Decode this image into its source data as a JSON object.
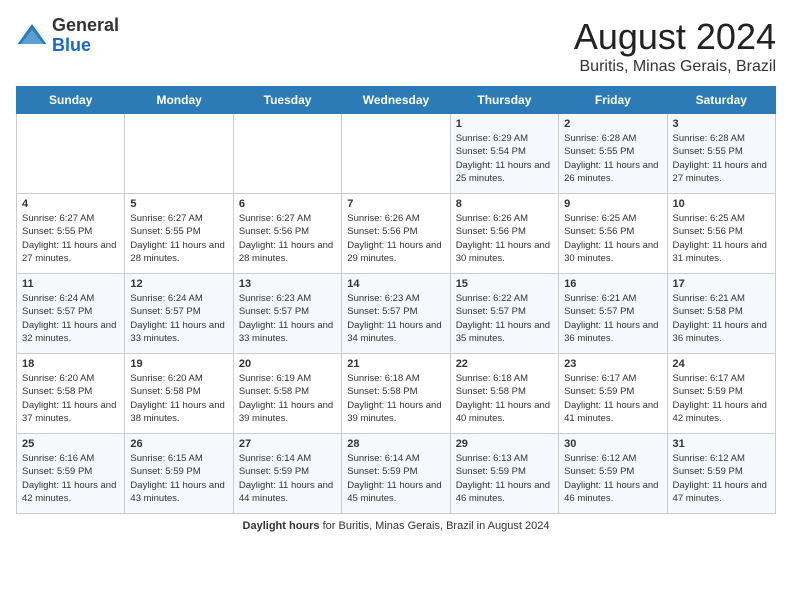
{
  "app": {
    "logo_general": "General",
    "logo_blue": "Blue"
  },
  "header": {
    "title": "August 2024",
    "subtitle": "Buritis, Minas Gerais, Brazil"
  },
  "calendar": {
    "days_of_week": [
      "Sunday",
      "Monday",
      "Tuesday",
      "Wednesday",
      "Thursday",
      "Friday",
      "Saturday"
    ],
    "weeks": [
      [
        {
          "day": "",
          "info": ""
        },
        {
          "day": "",
          "info": ""
        },
        {
          "day": "",
          "info": ""
        },
        {
          "day": "",
          "info": ""
        },
        {
          "day": "1",
          "info": "Sunrise: 6:29 AM\nSunset: 5:54 PM\nDaylight: 11 hours and 25 minutes."
        },
        {
          "day": "2",
          "info": "Sunrise: 6:28 AM\nSunset: 5:55 PM\nDaylight: 11 hours and 26 minutes."
        },
        {
          "day": "3",
          "info": "Sunrise: 6:28 AM\nSunset: 5:55 PM\nDaylight: 11 hours and 27 minutes."
        }
      ],
      [
        {
          "day": "4",
          "info": "Sunrise: 6:27 AM\nSunset: 5:55 PM\nDaylight: 11 hours and 27 minutes."
        },
        {
          "day": "5",
          "info": "Sunrise: 6:27 AM\nSunset: 5:55 PM\nDaylight: 11 hours and 28 minutes."
        },
        {
          "day": "6",
          "info": "Sunrise: 6:27 AM\nSunset: 5:56 PM\nDaylight: 11 hours and 28 minutes."
        },
        {
          "day": "7",
          "info": "Sunrise: 6:26 AM\nSunset: 5:56 PM\nDaylight: 11 hours and 29 minutes."
        },
        {
          "day": "8",
          "info": "Sunrise: 6:26 AM\nSunset: 5:56 PM\nDaylight: 11 hours and 30 minutes."
        },
        {
          "day": "9",
          "info": "Sunrise: 6:25 AM\nSunset: 5:56 PM\nDaylight: 11 hours and 30 minutes."
        },
        {
          "day": "10",
          "info": "Sunrise: 6:25 AM\nSunset: 5:56 PM\nDaylight: 11 hours and 31 minutes."
        }
      ],
      [
        {
          "day": "11",
          "info": "Sunrise: 6:24 AM\nSunset: 5:57 PM\nDaylight: 11 hours and 32 minutes."
        },
        {
          "day": "12",
          "info": "Sunrise: 6:24 AM\nSunset: 5:57 PM\nDaylight: 11 hours and 33 minutes."
        },
        {
          "day": "13",
          "info": "Sunrise: 6:23 AM\nSunset: 5:57 PM\nDaylight: 11 hours and 33 minutes."
        },
        {
          "day": "14",
          "info": "Sunrise: 6:23 AM\nSunset: 5:57 PM\nDaylight: 11 hours and 34 minutes."
        },
        {
          "day": "15",
          "info": "Sunrise: 6:22 AM\nSunset: 5:57 PM\nDaylight: 11 hours and 35 minutes."
        },
        {
          "day": "16",
          "info": "Sunrise: 6:21 AM\nSunset: 5:57 PM\nDaylight: 11 hours and 36 minutes."
        },
        {
          "day": "17",
          "info": "Sunrise: 6:21 AM\nSunset: 5:58 PM\nDaylight: 11 hours and 36 minutes."
        }
      ],
      [
        {
          "day": "18",
          "info": "Sunrise: 6:20 AM\nSunset: 5:58 PM\nDaylight: 11 hours and 37 minutes."
        },
        {
          "day": "19",
          "info": "Sunrise: 6:20 AM\nSunset: 5:58 PM\nDaylight: 11 hours and 38 minutes."
        },
        {
          "day": "20",
          "info": "Sunrise: 6:19 AM\nSunset: 5:58 PM\nDaylight: 11 hours and 39 minutes."
        },
        {
          "day": "21",
          "info": "Sunrise: 6:18 AM\nSunset: 5:58 PM\nDaylight: 11 hours and 39 minutes."
        },
        {
          "day": "22",
          "info": "Sunrise: 6:18 AM\nSunset: 5:58 PM\nDaylight: 11 hours and 40 minutes."
        },
        {
          "day": "23",
          "info": "Sunrise: 6:17 AM\nSunset: 5:59 PM\nDaylight: 11 hours and 41 minutes."
        },
        {
          "day": "24",
          "info": "Sunrise: 6:17 AM\nSunset: 5:59 PM\nDaylight: 11 hours and 42 minutes."
        }
      ],
      [
        {
          "day": "25",
          "info": "Sunrise: 6:16 AM\nSunset: 5:59 PM\nDaylight: 11 hours and 42 minutes."
        },
        {
          "day": "26",
          "info": "Sunrise: 6:15 AM\nSunset: 5:59 PM\nDaylight: 11 hours and 43 minutes."
        },
        {
          "day": "27",
          "info": "Sunrise: 6:14 AM\nSunset: 5:59 PM\nDaylight: 11 hours and 44 minutes."
        },
        {
          "day": "28",
          "info": "Sunrise: 6:14 AM\nSunset: 5:59 PM\nDaylight: 11 hours and 45 minutes."
        },
        {
          "day": "29",
          "info": "Sunrise: 6:13 AM\nSunset: 5:59 PM\nDaylight: 11 hours and 46 minutes."
        },
        {
          "day": "30",
          "info": "Sunrise: 6:12 AM\nSunset: 5:59 PM\nDaylight: 11 hours and 46 minutes."
        },
        {
          "day": "31",
          "info": "Sunrise: 6:12 AM\nSunset: 5:59 PM\nDaylight: 11 hours and 47 minutes."
        }
      ]
    ]
  },
  "footer": {
    "label": "Daylight hours",
    "description": " for Buritis, Minas Gerais, Brazil in August 2024"
  }
}
